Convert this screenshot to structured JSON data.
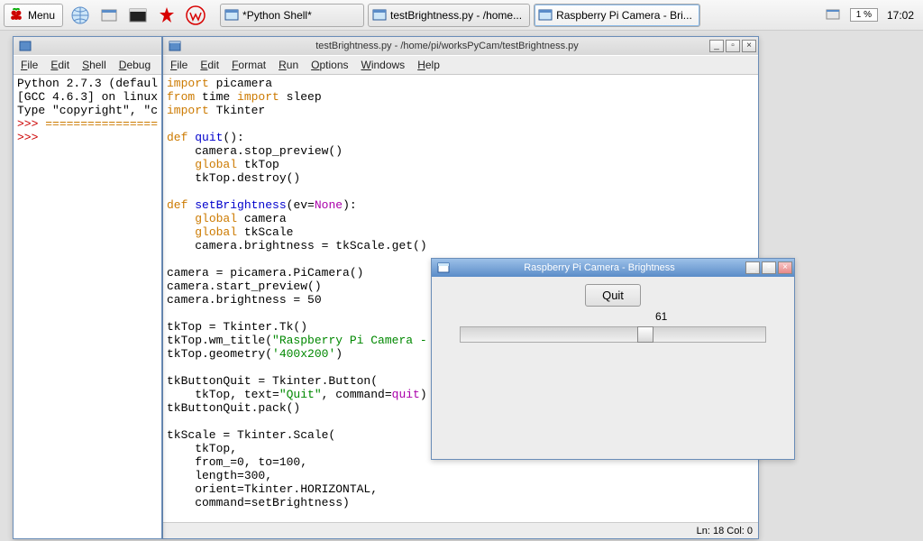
{
  "taskbar": {
    "menu_label": "Menu",
    "tasks": [
      {
        "label": "*Python Shell*",
        "active": false
      },
      {
        "label": "testBrightness.py - /home...",
        "active": false
      },
      {
        "label": "Raspberry Pi Camera - Bri...",
        "active": true
      }
    ],
    "cpu": "1 %",
    "clock": "17:02"
  },
  "editor_window": {
    "title": "testBrightness.py - /home/pi/worksPyCam/testBrightness.py",
    "menus": [
      "File",
      "Edit",
      "Format",
      "Run",
      "Options",
      "Windows",
      "Help"
    ],
    "status": "Ln: 18 Col: 0",
    "code_lines": [
      {
        "t": "import",
        "c": "orange"
      },
      {
        "t": " picamera\n",
        "c": ""
      },
      {
        "t": "from",
        "c": "orange"
      },
      {
        "t": " time ",
        "c": ""
      },
      {
        "t": "import",
        "c": "orange"
      },
      {
        "t": " sleep\n",
        "c": ""
      },
      {
        "t": "import",
        "c": "orange"
      },
      {
        "t": " Tkinter\n",
        "c": ""
      },
      {
        "t": "\n",
        "c": ""
      },
      {
        "t": "def",
        "c": "orange"
      },
      {
        "t": " ",
        "c": ""
      },
      {
        "t": "quit",
        "c": "blue"
      },
      {
        "t": "():\n",
        "c": ""
      },
      {
        "t": "    camera.stop_preview()\n",
        "c": ""
      },
      {
        "t": "    ",
        "c": ""
      },
      {
        "t": "global",
        "c": "orange"
      },
      {
        "t": " tkTop\n",
        "c": ""
      },
      {
        "t": "    tkTop.destroy()\n",
        "c": ""
      },
      {
        "t": "\n",
        "c": ""
      },
      {
        "t": "def",
        "c": "orange"
      },
      {
        "t": " ",
        "c": ""
      },
      {
        "t": "setBrightness",
        "c": "blue"
      },
      {
        "t": "(ev=",
        "c": ""
      },
      {
        "t": "None",
        "c": "purple"
      },
      {
        "t": "):\n",
        "c": ""
      },
      {
        "t": "    ",
        "c": ""
      },
      {
        "t": "global",
        "c": "orange"
      },
      {
        "t": " camera\n",
        "c": ""
      },
      {
        "t": "    ",
        "c": ""
      },
      {
        "t": "global",
        "c": "orange"
      },
      {
        "t": " tkScale\n",
        "c": ""
      },
      {
        "t": "    camera.brightness = tkScale.get()\n",
        "c": ""
      },
      {
        "t": "\n",
        "c": ""
      },
      {
        "t": "camera = picamera.PiCamera()\n",
        "c": ""
      },
      {
        "t": "camera.start_preview()\n",
        "c": ""
      },
      {
        "t": "camera.brightness = 50\n",
        "c": ""
      },
      {
        "t": "\n",
        "c": ""
      },
      {
        "t": "tkTop = Tkinter.Tk()\n",
        "c": ""
      },
      {
        "t": "tkTop.wm_title(",
        "c": ""
      },
      {
        "t": "\"Raspberry Pi Camera - ",
        "c": "green"
      },
      {
        "t": "\n",
        "c": ""
      },
      {
        "t": "tkTop.geometry(",
        "c": ""
      },
      {
        "t": "'400x200'",
        "c": "green"
      },
      {
        "t": ")\n",
        "c": ""
      },
      {
        "t": "\n",
        "c": ""
      },
      {
        "t": "tkButtonQuit = Tkinter.Button(\n",
        "c": ""
      },
      {
        "t": "    tkTop, text=",
        "c": ""
      },
      {
        "t": "\"Quit\"",
        "c": "green"
      },
      {
        "t": ", command=",
        "c": ""
      },
      {
        "t": "quit",
        "c": "purple"
      },
      {
        "t": ")\n",
        "c": ""
      },
      {
        "t": "tkButtonQuit.pack()\n",
        "c": ""
      },
      {
        "t": "\n",
        "c": ""
      },
      {
        "t": "tkScale = Tkinter.Scale(\n",
        "c": ""
      },
      {
        "t": "    tkTop,\n",
        "c": ""
      },
      {
        "t": "    from_=0, to=100,\n",
        "c": ""
      },
      {
        "t": "    length=300,\n",
        "c": ""
      },
      {
        "t": "    orient=Tkinter.HORIZONTAL,\n",
        "c": ""
      },
      {
        "t": "    command=setBrightness)\n",
        "c": ""
      }
    ]
  },
  "shell_window": {
    "menus": [
      "File",
      "Edit",
      "Shell",
      "Debug"
    ],
    "text": "Python 2.7.3 (defaul\n[GCC 4.6.3] on linux\nType \"copyright\", \"c\n>>> ================\n>>> "
  },
  "tk_window": {
    "title": "Raspberry Pi Camera - Brightness",
    "button": "Quit",
    "scale_value": "61",
    "scale_pos_pct": 61
  }
}
